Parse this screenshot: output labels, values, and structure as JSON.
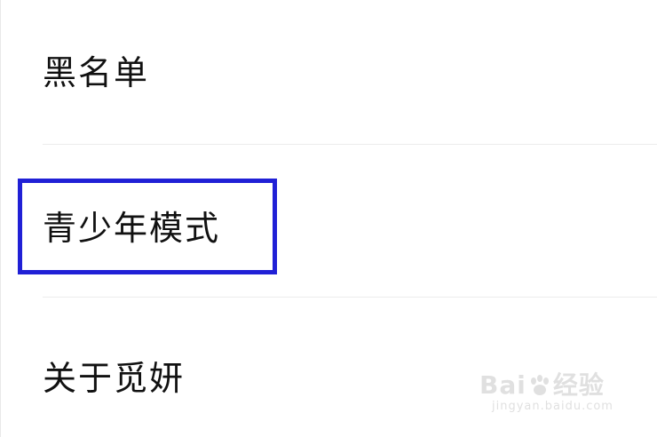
{
  "settings": {
    "items": [
      {
        "label": "黑名单"
      },
      {
        "label": "青少年模式"
      },
      {
        "label": "关于觅妍"
      }
    ]
  },
  "highlight": {
    "target": "青少年模式",
    "color": "#2020d6"
  },
  "watermark": {
    "logo_text_before": "Bai",
    "logo_text_after": "经验",
    "url": "jingyan.baidu.com",
    "icon": "paw-icon"
  }
}
